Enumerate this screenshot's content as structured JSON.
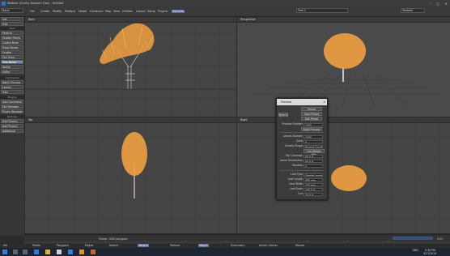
{
  "window": {
    "title": "Modeler (Cherry Blossom Tree) - Untitled",
    "controls": [
      "–",
      "□",
      "✕"
    ]
  },
  "menubar": {
    "items": [
      "File",
      "Create",
      "Modify",
      "Multiply",
      "Detail",
      "Construct",
      "Map",
      "View",
      "Utilities",
      "Layout",
      "Setup",
      "Plugins",
      "Particles"
    ],
    "active_index": 12,
    "mode_combo": "Basic",
    "layer_combo": "Tree 1",
    "mid_combo": "Modeler"
  },
  "toolbar": {
    "buttons": [
      "Get",
      "Edit",
      "Particle",
      "Scatter Points",
      "Create Bone",
      "Place Bones",
      "Scatter",
      "Fire Trace",
      "Tree Model",
      "Spline",
      "Utility"
    ],
    "mid_buttons": [
      "Batch Process",
      "Layers",
      "Tree",
      "Add Command",
      "File Manager",
      "Plugin Manager"
    ],
    "headers": [
      "Tools",
      "Commands",
      "Plugins",
      "Modules"
    ],
    "bottom_buttons": [
      "Edit Plugins",
      "Add Plugins",
      "Additional"
    ]
  },
  "viewports": {
    "tl_label": "Back",
    "tr_label": "Perspective",
    "bl_label": "Top",
    "br_label": "Right"
  },
  "dialog": {
    "title": "Preview",
    "preset_combo": "Preset",
    "presets": [
      "Save Preset",
      "Edit Preset"
    ],
    "rows": [
      {
        "label": "Branch",
        "value": "Tree"
      },
      {
        "label": "Preview Number",
        "value": "1000"
      },
      {
        "label": "Leaves Number",
        "value": "1500"
      },
      {
        "label": "Seed",
        "value": "0"
      },
      {
        "label": "Gravity Shape",
        "value": "Normal Gravity"
      },
      {
        "label": "Top Coverage",
        "value": "80.0 %"
      },
      {
        "label": "Leave Distribution",
        "value": "50.0 %"
      },
      {
        "label": "Random",
        "value": "0"
      },
      {
        "label": "Leaf Type",
        "value": "Simple Leaves"
      },
      {
        "label": "Leaf Length",
        "value": "400 mm"
      },
      {
        "label": "Leaf Width",
        "value": "100 mm"
      },
      {
        "label": "Leaf Scale",
        "value": "100.0 %"
      },
      {
        "label": "Curl",
        "value": "20.0 %"
      }
    ],
    "action_button": "Build Preview",
    "mid_button": "Get Weight Map"
  },
  "timeline": {
    "frame_text": "Frame: 1000 polygons",
    "status_text": "0.01"
  },
  "statusbar": {
    "items": [
      "Sel",
      "Points",
      "Polygons",
      "Edges",
      "Sketch",
      "Weight",
      "Texture",
      "Morph",
      "Symmetry",
      "Action Center",
      "Mouse"
    ]
  },
  "taskbar": {
    "time": "5:38 PM",
    "date": "4/27/2019",
    "lang": "ENG"
  },
  "colors": {
    "tree_leaf": "#f0a040",
    "trunk": "#d8d8d8",
    "accent": "#6f8fc2"
  }
}
